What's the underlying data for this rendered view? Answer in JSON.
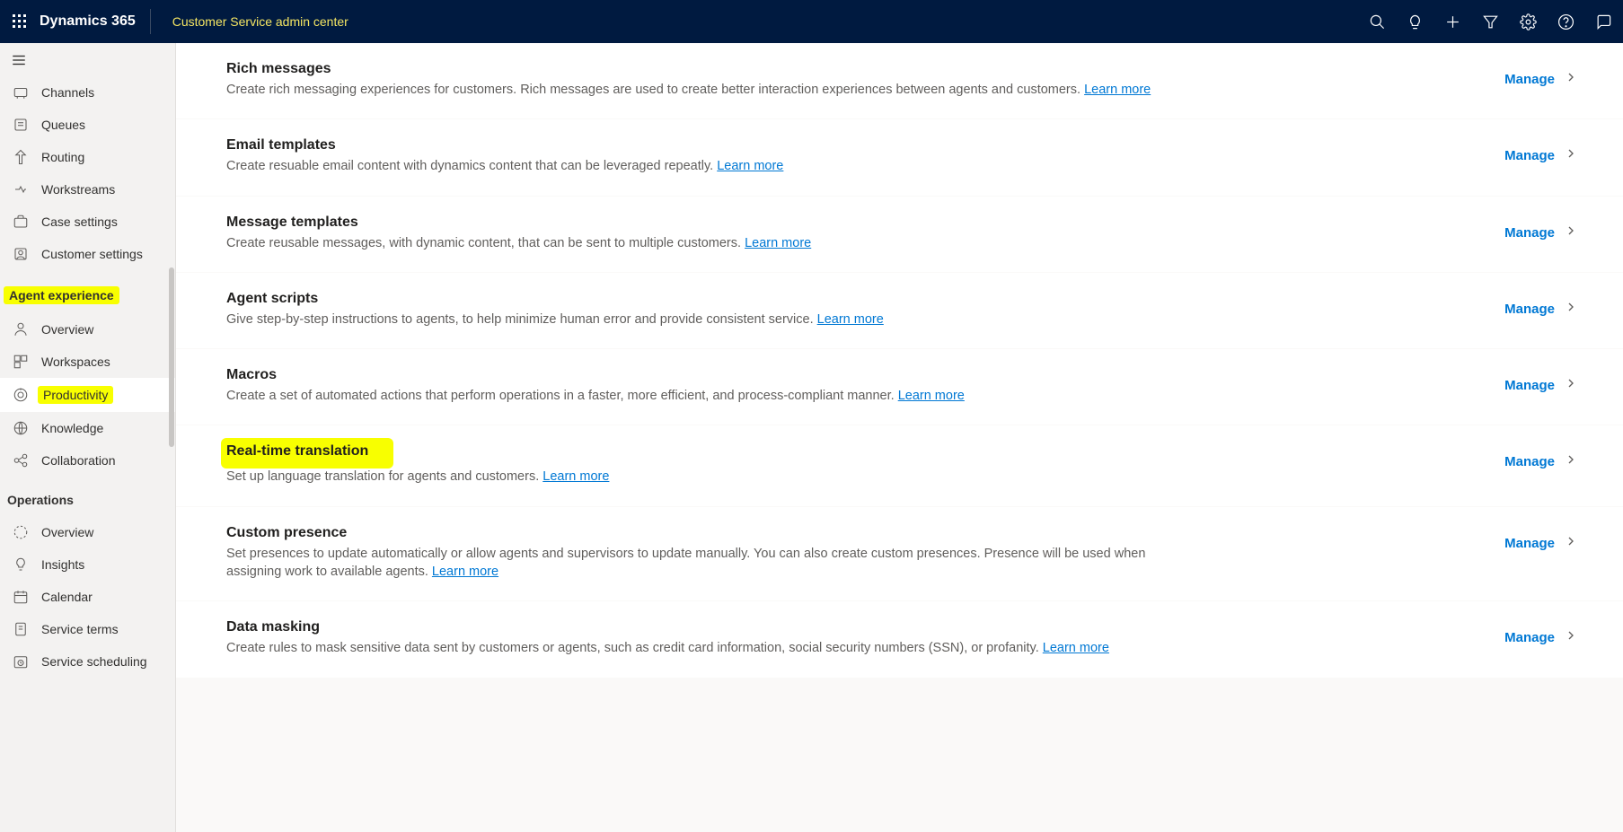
{
  "header": {
    "brand": "Dynamics 365",
    "app": "Customer Service admin center"
  },
  "sidebar": {
    "items_top": [
      {
        "key": "channels",
        "label": "Channels"
      },
      {
        "key": "queues",
        "label": "Queues"
      },
      {
        "key": "routing",
        "label": "Routing"
      },
      {
        "key": "workstreams",
        "label": "Workstreams"
      },
      {
        "key": "case-settings",
        "label": "Case settings"
      },
      {
        "key": "customer-settings",
        "label": "Customer settings"
      }
    ],
    "group_agent": "Agent experience",
    "items_agent": [
      {
        "key": "overview-agent",
        "label": "Overview"
      },
      {
        "key": "workspaces",
        "label": "Workspaces"
      },
      {
        "key": "productivity",
        "label": "Productivity",
        "selected": true
      },
      {
        "key": "knowledge",
        "label": "Knowledge"
      },
      {
        "key": "collaboration",
        "label": "Collaboration"
      }
    ],
    "group_ops": "Operations",
    "items_ops": [
      {
        "key": "overview-ops",
        "label": "Overview"
      },
      {
        "key": "insights",
        "label": "Insights"
      },
      {
        "key": "calendar",
        "label": "Calendar"
      },
      {
        "key": "service-terms",
        "label": "Service terms"
      },
      {
        "key": "service-scheduling",
        "label": "Service scheduling"
      }
    ]
  },
  "cards": [
    {
      "key": "rich-messages",
      "title": "Rich messages",
      "desc": "Create rich messaging experiences for customers. Rich messages are used to create better interaction experiences between agents and customers. ",
      "learn": "Learn more",
      "manage": "Manage"
    },
    {
      "key": "email-templates",
      "title": "Email templates",
      "desc": "Create resuable email content with dynamics content that can be leveraged repeatly. ",
      "learn": "Learn more",
      "manage": "Manage"
    },
    {
      "key": "message-templates",
      "title": "Message templates",
      "desc": "Create reusable messages, with dynamic content, that can be sent to multiple customers. ",
      "learn": "Learn more",
      "manage": "Manage"
    },
    {
      "key": "agent-scripts",
      "title": "Agent scripts",
      "desc": "Give step-by-step instructions to agents, to help minimize human error and provide consistent service. ",
      "learn": "Learn more",
      "manage": "Manage"
    },
    {
      "key": "macros",
      "title": "Macros",
      "desc": "Create a set of automated actions that perform operations in a faster, more efficient, and process-compliant manner. ",
      "learn": "Learn more",
      "manage": "Manage"
    },
    {
      "key": "real-time-translation",
      "title": "Real-time translation",
      "desc": "Set up language translation for agents and customers. ",
      "learn": "Learn more",
      "manage": "Manage",
      "highlighted": true
    },
    {
      "key": "custom-presence",
      "title": "Custom presence",
      "desc": "Set presences to update automatically or allow agents and supervisors to update manually. You can also create custom presences. Presence will be used when assigning work to available agents. ",
      "learn": "Learn more",
      "manage": "Manage"
    },
    {
      "key": "data-masking",
      "title": "Data masking",
      "desc": "Create rules to mask sensitive data sent by customers or agents, such as credit card information, social security numbers (SSN), or profanity. ",
      "learn": "Learn more",
      "manage": "Manage"
    }
  ]
}
